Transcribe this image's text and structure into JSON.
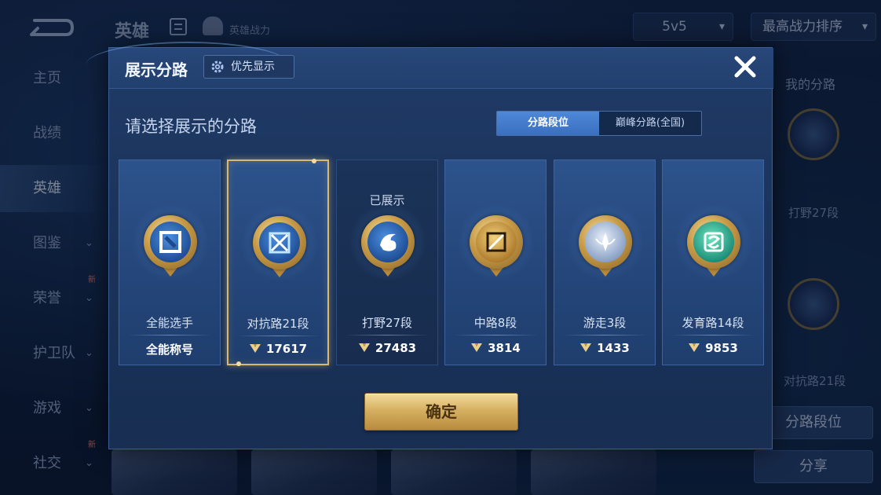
{
  "background": {
    "header": {
      "title": "英雄",
      "subtitle": "英雄战力"
    },
    "mode_dropdown": {
      "value": "5v5"
    },
    "sort_dropdown": {
      "value": "最高战力排序"
    },
    "nav": [
      {
        "label": "主页",
        "has_chevron": false,
        "is_new": false
      },
      {
        "label": "战绩",
        "has_chevron": false,
        "is_new": false
      },
      {
        "label": "英雄",
        "has_chevron": false,
        "is_new": false,
        "active": true
      },
      {
        "label": "图鉴",
        "has_chevron": true,
        "is_new": false
      },
      {
        "label": "荣誉",
        "has_chevron": true,
        "is_new": true
      },
      {
        "label": "护卫队",
        "has_chevron": true,
        "is_new": false
      },
      {
        "label": "游戏",
        "has_chevron": true,
        "is_new": false
      },
      {
        "label": "社交",
        "has_chevron": true,
        "is_new": true
      }
    ],
    "new_badge": "新",
    "right_panel": {
      "title": "我的分路",
      "emblem_1_label": "打野27段",
      "emblem_2_label": "对抗路21段",
      "btn_lane_rank": "分路段位",
      "btn_share": "分享"
    }
  },
  "modal": {
    "title": "展示分路",
    "priority_button": "优先显示",
    "prompt": "请选择展示的分路",
    "tabs": [
      {
        "label": "分路段位",
        "active": true
      },
      {
        "label": "巅峰分路(全国)",
        "active": false
      }
    ],
    "shown_label": "已展示",
    "cards": [
      {
        "name": "全能选手",
        "value": "全能称号",
        "show_power_icon": false,
        "emblem": "blue",
        "glyph": "allround-icon",
        "selected": false,
        "shown": false
      },
      {
        "name": "对抗路21段",
        "value": "17617",
        "show_power_icon": true,
        "emblem": "blue",
        "glyph": "clash-lane-icon",
        "selected": true,
        "shown": false
      },
      {
        "name": "打野27段",
        "value": "27483",
        "show_power_icon": true,
        "emblem": "blue",
        "glyph": "jungle-icon",
        "selected": false,
        "shown": true
      },
      {
        "name": "中路8段",
        "value": "3814",
        "show_power_icon": true,
        "emblem": "gold",
        "glyph": "mid-lane-icon",
        "selected": false,
        "shown": false
      },
      {
        "name": "游走3段",
        "value": "1433",
        "show_power_icon": true,
        "emblem": "silver",
        "glyph": "roam-icon",
        "selected": false,
        "shown": false
      },
      {
        "name": "发育路14段",
        "value": "9853",
        "show_power_icon": true,
        "emblem": "green",
        "glyph": "farm-lane-icon",
        "selected": false,
        "shown": false
      }
    ],
    "confirm_button": "确定"
  },
  "colors": {
    "accent_gold": "#d9b870",
    "tab_active": "#3a6fbf",
    "modal_bg": "#1f3b66"
  }
}
